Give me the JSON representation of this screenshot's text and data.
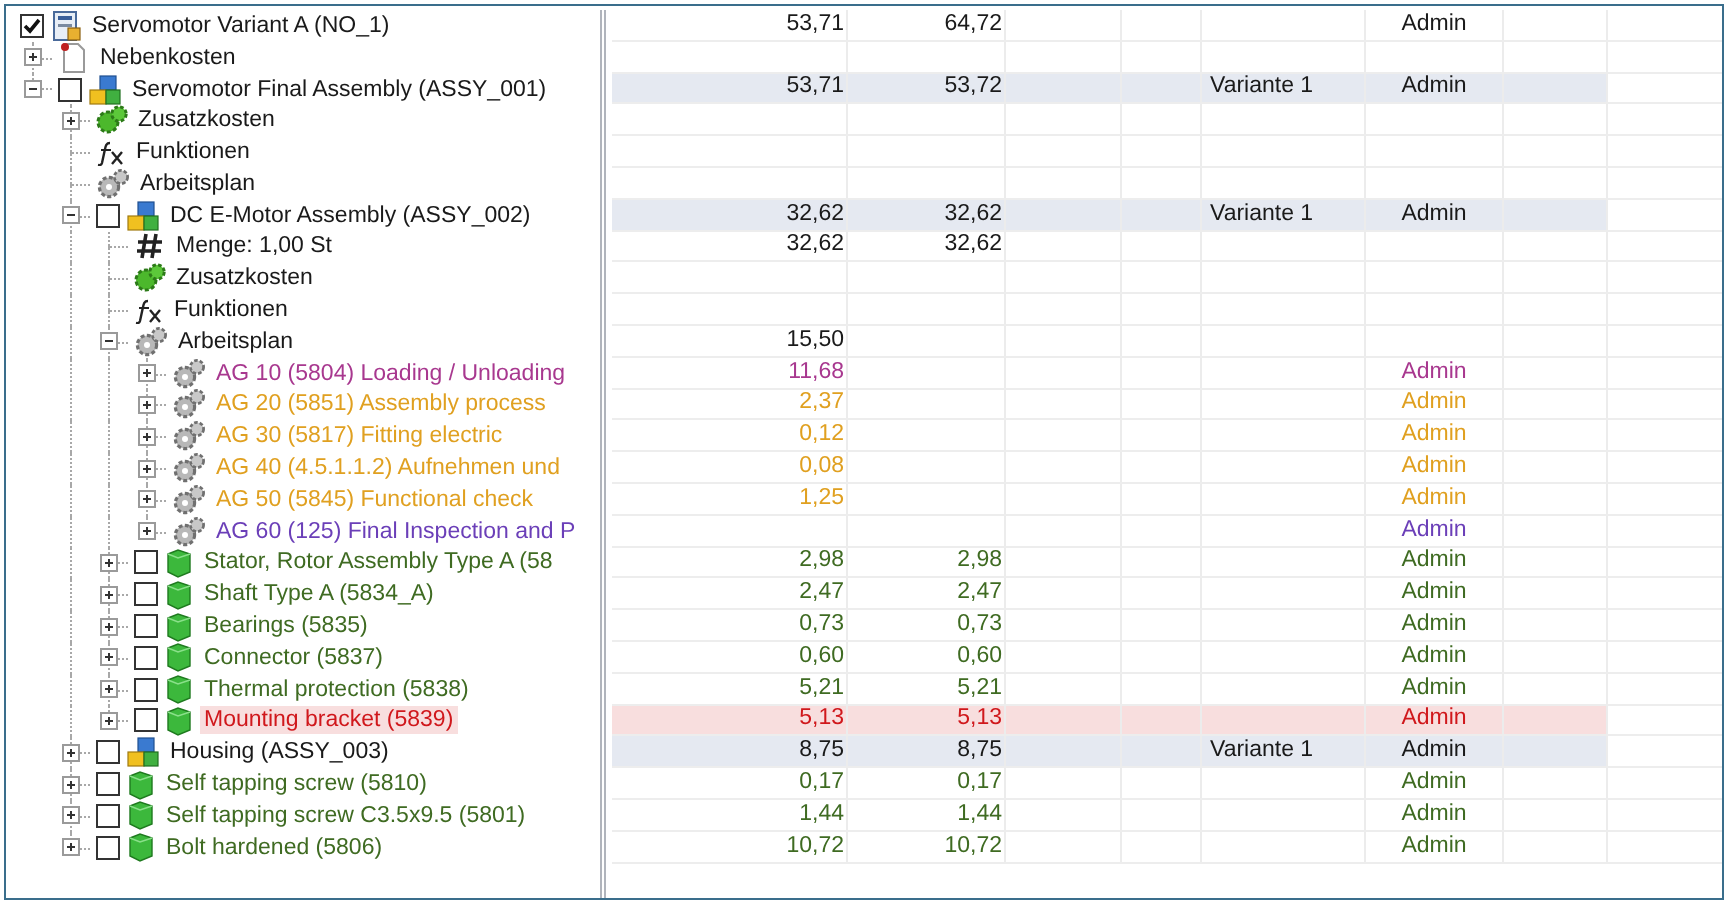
{
  "tree": [
    {
      "label": "Servomotor Variant A (NO_1)",
      "kind": "variant",
      "checked": true,
      "highlighted": false,
      "flagged": false,
      "color": "#1a1a1a",
      "column_1": "53,71",
      "column_2": "64,72",
      "column_6": "Admin",
      "children": [
        {
          "label": "Nebenkosten",
          "kind": "document",
          "expanded": false,
          "highlighted": false,
          "flagged": false,
          "color": "#1a1a1a"
        },
        {
          "label": "Servomotor Final Assembly (ASSY_001)",
          "kind": "assembly",
          "expanded": true,
          "checked": false,
          "highlighted": true,
          "flagged": false,
          "color": "#1a1a1a",
          "column_1": "53,71",
          "column_2": "53,72",
          "column_5": "Variante 1",
          "column_6": "Admin",
          "children": [
            {
              "label": "Zusatzkosten",
              "kind": "costs",
              "expanded": false,
              "highlighted": false,
              "flagged": false,
              "color": "#1a1a1a"
            },
            {
              "label": "Funktionen",
              "kind": "functions",
              "highlighted": false,
              "flagged": false,
              "color": "#1a1a1a"
            },
            {
              "label": "Arbeitsplan",
              "kind": "routing",
              "highlighted": false,
              "flagged": false,
              "color": "#1a1a1a"
            },
            {
              "label": "DC E-Motor Assembly (ASSY_002)",
              "kind": "assembly",
              "expanded": true,
              "checked": false,
              "highlighted": true,
              "flagged": false,
              "color": "#1a1a1a",
              "column_1": "32,62",
              "column_2": "32,62",
              "column_5": "Variante 1",
              "column_6": "Admin",
              "children": [
                {
                  "label": "Menge: 1,00 St",
                  "kind": "quantity",
                  "highlighted": false,
                  "flagged": false,
                  "color": "#1a1a1a",
                  "column_1": "32,62",
                  "column_2": "32,62"
                },
                {
                  "label": "Zusatzkosten",
                  "kind": "costs",
                  "highlighted": false,
                  "flagged": false,
                  "color": "#1a1a1a"
                },
                {
                  "label": "Funktionen",
                  "kind": "functions",
                  "highlighted": false,
                  "flagged": false,
                  "color": "#1a1a1a"
                },
                {
                  "label": "Arbeitsplan",
                  "kind": "routing",
                  "expanded": true,
                  "highlighted": false,
                  "flagged": false,
                  "color": "#1a1a1a",
                  "column_1": "15,50",
                  "children": [
                    {
                      "label": "AG 10 (5804) Loading / Unloading",
                      "kind": "operation",
                      "expanded": false,
                      "highlighted": false,
                      "flagged": false,
                      "color": "#a8388f",
                      "column_1": "11,68",
                      "column_6": "Admin"
                    },
                    {
                      "label": "AG 20 (5851) Assembly process",
                      "kind": "operation",
                      "expanded": false,
                      "highlighted": false,
                      "flagged": false,
                      "color": "#e0a020",
                      "column_1": "2,37",
                      "column_6": "Admin"
                    },
                    {
                      "label": "AG 30 (5817) Fitting electric",
                      "kind": "operation",
                      "expanded": false,
                      "highlighted": false,
                      "flagged": false,
                      "color": "#e0a020",
                      "column_1": "0,12",
                      "column_6": "Admin"
                    },
                    {
                      "label": "AG 40 (4.5.1.1.2) Aufnehmen und",
                      "kind": "operation",
                      "expanded": false,
                      "highlighted": false,
                      "flagged": false,
                      "color": "#e0a020",
                      "column_1": "0,08",
                      "column_6": "Admin"
                    },
                    {
                      "label": "AG 50 (5845) Functional check",
                      "kind": "operation",
                      "expanded": false,
                      "highlighted": false,
                      "flagged": false,
                      "color": "#e0a020",
                      "column_1": "1,25",
                      "column_6": "Admin"
                    },
                    {
                      "label": "AG 60 (125) Final Inspection and P",
                      "kind": "operation",
                      "expanded": false,
                      "highlighted": false,
                      "flagged": false,
                      "color": "#6b3fb8",
                      "column_6": "Admin"
                    }
                  ]
                },
                {
                  "label": "Stator, Rotor Assembly Type A (58",
                  "kind": "part",
                  "expanded": false,
                  "checked": false,
                  "highlighted": false,
                  "flagged": false,
                  "color": "#3f6b22",
                  "column_1": "2,98",
                  "column_2": "2,98",
                  "column_6": "Admin"
                },
                {
                  "label": "Shaft Type A (5834_A)",
                  "kind": "part",
                  "expanded": false,
                  "checked": false,
                  "highlighted": false,
                  "flagged": false,
                  "color": "#3f6b22",
                  "column_1": "2,47",
                  "column_2": "2,47",
                  "column_6": "Admin"
                },
                {
                  "label": "Bearings (5835)",
                  "kind": "part",
                  "expanded": false,
                  "checked": false,
                  "highlighted": false,
                  "flagged": false,
                  "color": "#3f6b22",
                  "column_1": "0,73",
                  "column_2": "0,73",
                  "column_6": "Admin"
                },
                {
                  "label": "Connector (5837)",
                  "kind": "part",
                  "expanded": false,
                  "checked": false,
                  "highlighted": false,
                  "flagged": false,
                  "color": "#3f6b22",
                  "column_1": "0,60",
                  "column_2": "0,60",
                  "column_6": "Admin"
                },
                {
                  "label": "Thermal protection (5838)",
                  "kind": "part",
                  "expanded": false,
                  "checked": false,
                  "highlighted": false,
                  "flagged": false,
                  "color": "#3f6b22",
                  "column_1": "5,21",
                  "column_2": "5,21",
                  "column_6": "Admin"
                },
                {
                  "label": "Mounting bracket (5839)",
                  "kind": "part",
                  "expanded": false,
                  "checked": false,
                  "highlighted": false,
                  "flagged": true,
                  "color": "#d0181c",
                  "column_1": "5,13",
                  "column_2": "5,13",
                  "column_6": "Admin"
                }
              ]
            },
            {
              "label": "Housing (ASSY_003)",
              "kind": "assembly",
              "expanded": false,
              "checked": false,
              "highlighted": true,
              "flagged": false,
              "color": "#1a1a1a",
              "column_1": "8,75",
              "column_2": "8,75",
              "column_5": "Variante 1",
              "column_6": "Admin"
            },
            {
              "label": "Self tapping screw (5810)",
              "kind": "part",
              "expanded": false,
              "checked": false,
              "highlighted": false,
              "flagged": false,
              "color": "#3f6b22",
              "column_1": "0,17",
              "column_2": "0,17",
              "column_6": "Admin"
            },
            {
              "label": "Self tapping screw C3.5x9.5 (5801)",
              "kind": "part",
              "expanded": false,
              "checked": false,
              "highlighted": false,
              "flagged": false,
              "color": "#3f6b22",
              "column_1": "1,44",
              "column_2": "1,44",
              "column_6": "Admin"
            },
            {
              "label": "Bolt hardened (5806)",
              "kind": "part",
              "expanded": false,
              "checked": false,
              "highlighted": false,
              "flagged": false,
              "color": "#3f6b22",
              "column_1": "10,72",
              "column_2": "10,72",
              "column_6": "Admin"
            }
          ]
        }
      ]
    }
  ]
}
